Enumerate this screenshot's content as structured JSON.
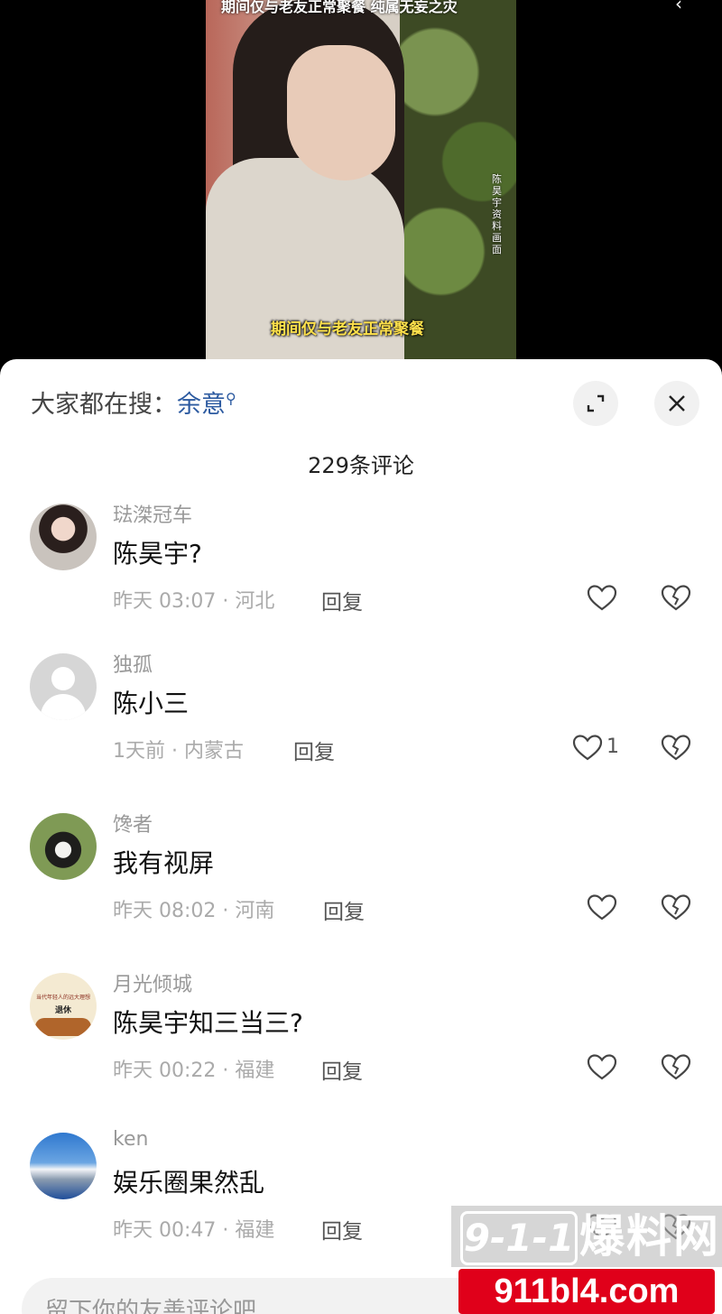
{
  "video": {
    "top_text": "期间仅与老友正常聚餐 纯属无妄之灾",
    "caption": "期间仅与老友正常聚餐",
    "side_label": "陈昊宇资料画面"
  },
  "header": {
    "search_prefix": "大家都在搜：",
    "search_term": "余意",
    "expand_icon": "expand-icon",
    "close_icon": "close-icon"
  },
  "comment_count": "229条评论",
  "comments": [
    {
      "user": "琺滐冠车",
      "text": "陈昊宇?",
      "meta": "昨天 03:07 · 河北",
      "reply": "回复",
      "likes": ""
    },
    {
      "user": "独孤",
      "text": "陈小三",
      "meta": "1天前 · 内蒙古",
      "reply": "回复",
      "likes": "1"
    },
    {
      "user": "馋者",
      "text": "我有视屏",
      "meta": "昨天 08:02 · 河南",
      "reply": "回复",
      "likes": ""
    },
    {
      "user": "月光倾城",
      "text": "陈昊宇知三当三?",
      "meta": "昨天 00:22 · 福建",
      "reply": "回复",
      "likes": "",
      "avatar_text": "当代年轻人的远大理想",
      "avatar_title": "退休"
    },
    {
      "user": "ken",
      "text": "娱乐圈果然乱",
      "meta": "昨天 00:47 · 福建",
      "reply": "回复",
      "likes": ""
    }
  ],
  "input": {
    "placeholder": "留下你的友善评论吧"
  },
  "watermark": {
    "brand_left": "9-1-1",
    "brand_right": "爆料网",
    "domain": "911bl4.com"
  },
  "colors": {
    "search_term": "#2c5aa0",
    "caption": "#ffe14b",
    "watermark_red": "#e0001a"
  }
}
